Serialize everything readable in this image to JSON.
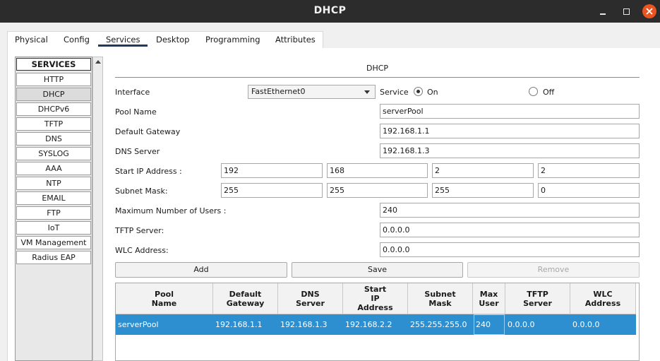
{
  "window": {
    "title": "DHCP"
  },
  "tabs": [
    "Physical",
    "Config",
    "Services",
    "Desktop",
    "Programming",
    "Attributes"
  ],
  "services": {
    "header": "SERVICES",
    "items": [
      "HTTP",
      "DHCP",
      "DHCPv6",
      "TFTP",
      "DNS",
      "SYSLOG",
      "AAA",
      "NTP",
      "EMAIL",
      "FTP",
      "IoT",
      "VM Management",
      "Radius EAP"
    ],
    "selected": "DHCP"
  },
  "form": {
    "section_title": "DHCP",
    "interface_label": "Interface",
    "interface_value": "FastEthernet0",
    "service_label": "Service",
    "on_label": "On",
    "off_label": "Off",
    "pool_name_label": "Pool Name",
    "pool_name_value": "serverPool",
    "default_gateway_label": "Default Gateway",
    "default_gateway_value": "192.168.1.1",
    "dns_server_label": "DNS Server",
    "dns_server_value": "192.168.1.3",
    "start_ip_label": "Start IP Address :",
    "start_ip": [
      "192",
      "168",
      "2",
      "2"
    ],
    "subnet_mask_label": "Subnet Mask:",
    "subnet_mask": [
      "255",
      "255",
      "255",
      "0"
    ],
    "max_users_label": "Maximum Number of Users :",
    "max_users_value": "240",
    "tftp_server_label": "TFTP Server:",
    "tftp_server_value": "0.0.0.0",
    "wlc_address_label": "WLC Address:",
    "wlc_address_value": "0.0.0.0",
    "add_label": "Add",
    "save_label": "Save",
    "remove_label": "Remove"
  },
  "table": {
    "columns": [
      "Pool\nName",
      "Default\nGateway",
      "DNS\nServer",
      "Start\nIP\nAddress",
      "Subnet\nMask",
      "Max\nUser",
      "TFTP\nServer",
      "WLC\nAddress"
    ],
    "rows": [
      [
        "serverPool",
        "192.168.1.1",
        "192.168.1.3",
        "192.168.2.2",
        "255.255.255.0",
        "240",
        "0.0.0.0",
        "0.0.0.0"
      ]
    ]
  },
  "colors": {
    "titlebar": "#2c2c2c",
    "close_button": "#e95420",
    "row_selected": "#2e8fd0",
    "tab_underline": "#1f3a5a"
  },
  "icons": {
    "minimize": "minimize-icon",
    "maximize": "maximize-icon",
    "close": "close-icon",
    "dropdown": "chevron-down-icon",
    "scroll_up": "scroll-up-arrow-icon"
  }
}
